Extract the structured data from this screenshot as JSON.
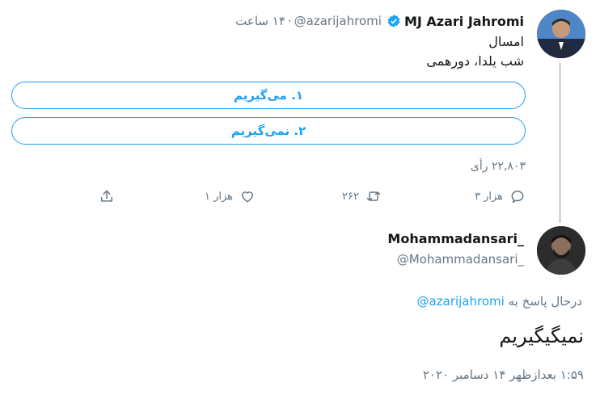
{
  "tweet1": {
    "display_name": "MJ Azari Jahromi",
    "handle": "@azarijahromi",
    "separator": "·",
    "time_ago": "۱۴ ساعت",
    "lines": [
      "امسال",
      "شب یلدا، دورهمی"
    ],
    "poll": {
      "options": [
        "۱. می‌گیریم",
        "۲. نمی‌گیریم"
      ],
      "votes_text": "۲۲,۸۰۳ رأی"
    },
    "actions": {
      "reply_count": "۳ هزار",
      "retweet_count": "۲۶۲",
      "like_count": "۱ هزار",
      "reply_icon": "reply-bubble-icon",
      "retweet_icon": "retweet-icon",
      "like_icon": "heart-icon",
      "share_icon": "share-upload-icon"
    },
    "accent_color": "#1da1f2"
  },
  "tweet2": {
    "display_name": "Mohammadansari_",
    "handle": "@Mohammadansari_",
    "replying_prefix": "درحال پاسخ به",
    "replying_mention": "@azarijahromi",
    "text": "نمیگیگیریم",
    "timestamp": "۱:۵۹ بعدازظهر ۱۴ دسامبر ۲۰۲۰"
  }
}
